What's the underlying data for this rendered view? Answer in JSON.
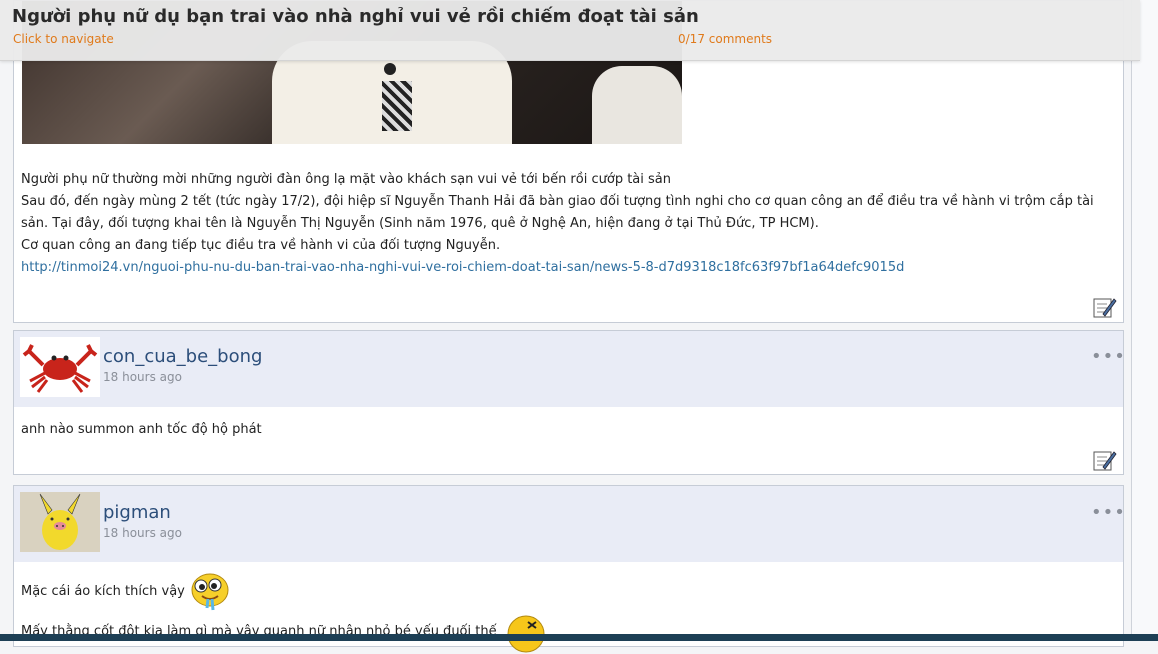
{
  "header": {
    "title": "Người phụ nữ dụ bạn trai vào nhà nghỉ vui vẻ rồi chiếm đoạt tài sản",
    "nav_label": "Click to navigate",
    "comments_count": "0/17 comments"
  },
  "post": {
    "paragraphs": [
      "Người phụ nữ thường mời những người đàn ông lạ mặt vào khách sạn vui vẻ tới bến rồi cướp tài sản",
      "Sau đó, đến ngày mùng 2 tết (tức ngày 17/2), đội hiệp sĩ Nguyễn Thanh Hải đã bàn giao đối tượng tình nghi cho cơ quan công an để điều tra về hành vi trộm cắp tài sản. Tại đây, đối tượng khai tên là Nguyễn Thị Nguyễn (Sinh năm 1976, quê ở Nghệ An, hiện đang ở tại Thủ Đức, TP HCM).",
      "Cơ quan công an đang tiếp tục điều tra về hành vi của đối tượng Nguyễn."
    ],
    "link": "http://tinmoi24.vn/nguoi-phu-nu-du-ban-trai-vao-nha-nghi-vui-ve-roi-chiem-doat-tai-san/news-5-8-d7d9318c18fc63f97bf1a64defc9015d"
  },
  "comments": [
    {
      "username": "con_cua_be_bong",
      "time": "18 hours ago",
      "text": "anh nào summon anh tốc độ hộ phát"
    },
    {
      "username": "pigman",
      "time": "18 hours ago",
      "text": "Mặc cái áo kích thích vậy",
      "text2": "Mấy thằng cốt đột kia làm gì mà vây quanh nữ nhân nhỏ bé yếu đuối thế"
    }
  ],
  "colors": {
    "accent_orange": "#e07a1b",
    "username_blue": "#2c4e7a",
    "link_blue": "#2f6f9f",
    "comment_header_bg": "#e9ecf6"
  },
  "icons": [
    "edit-icon",
    "more-options-icon",
    "crab-avatar",
    "pikachu-avatar",
    "drooling-emoji",
    "laughing-emoji"
  ]
}
